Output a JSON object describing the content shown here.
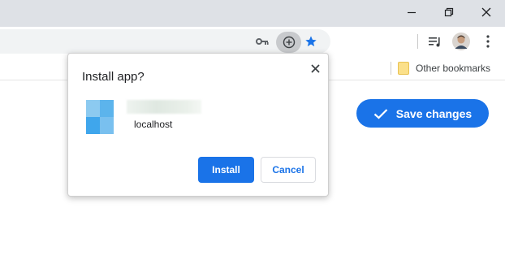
{
  "window_controls": {
    "minimize_icon": "minimize-icon",
    "restore_icon": "restore-icon",
    "close_icon": "close-icon"
  },
  "toolbar": {
    "key_icon": "key-icon",
    "install_icon": "install-app-icon",
    "star_icon": "star-icon",
    "media_icon": "media-control-icon",
    "avatar_icon": "profile-avatar-icon",
    "menu_icon": "kebab-menu-icon",
    "accent_color": "#1a73e8"
  },
  "bookmarks": {
    "other_bookmarks_label": "Other bookmarks"
  },
  "page": {
    "save_button_label": "Save changes"
  },
  "install_dialog": {
    "title": "Install app?",
    "app_origin": "localhost",
    "install_label": "Install",
    "cancel_label": "Cancel"
  }
}
